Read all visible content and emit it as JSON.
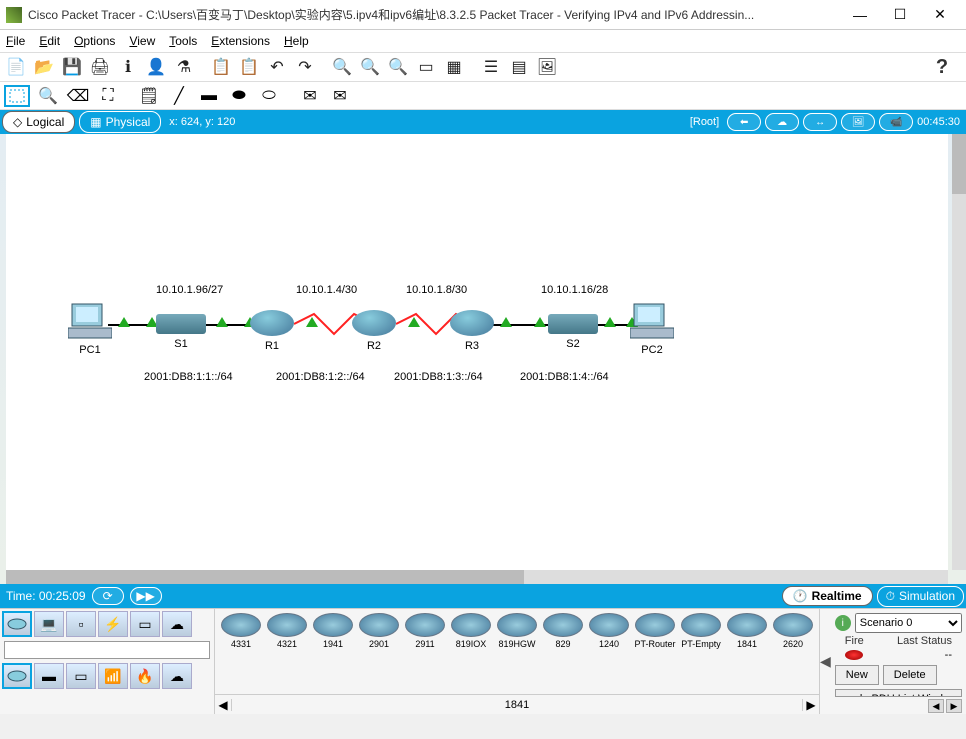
{
  "title": "Cisco Packet Tracer - C:\\Users\\百变马丁\\Desktop\\实验内容\\5.ipv4和ipv6编址\\8.3.2.5 Packet Tracer - Verifying IPv4 and IPv6 Addressin...",
  "menu": {
    "file": "File",
    "edit": "Edit",
    "options": "Options",
    "view": "View",
    "tools": "Tools",
    "extensions": "Extensions",
    "help": "Help"
  },
  "viewbar": {
    "logical": "Logical",
    "physical": "Physical",
    "coords": "x: 624, y: 120",
    "root": "[Root]",
    "time": "00:45:30"
  },
  "topology": {
    "pc1": "PC1",
    "pc2": "PC2",
    "s1": "S1",
    "s2": "S2",
    "r1": "R1",
    "r2": "R2",
    "r3": "R3",
    "net1_v4": "10.10.1.96/27",
    "net2_v4": "10.10.1.4/30",
    "net3_v4": "10.10.1.8/30",
    "net4_v4": "10.10.1.16/28",
    "net1_v6": "2001:DB8:1:1::/64",
    "net2_v6": "2001:DB8:1:2::/64",
    "net3_v6": "2001:DB8:1:3::/64",
    "net4_v6": "2001:DB8:1:4::/64"
  },
  "timebar": {
    "label": "Time: 00:25:09",
    "realtime": "Realtime",
    "simulation": "Simulation"
  },
  "devices": {
    "models": [
      "4331",
      "4321",
      "1941",
      "2901",
      "2911",
      "819IOX",
      "819HGW",
      "829",
      "1240",
      "PT-Router",
      "PT-Empty",
      "1841",
      "2620"
    ],
    "selected": "1841"
  },
  "scenario": {
    "dropdown": "Scenario 0",
    "col_fire": "Fire",
    "col_status": "Last Status",
    "row_status": "--",
    "new": "New",
    "delete": "Delete",
    "toggle": "ggle PDU List Windo"
  }
}
